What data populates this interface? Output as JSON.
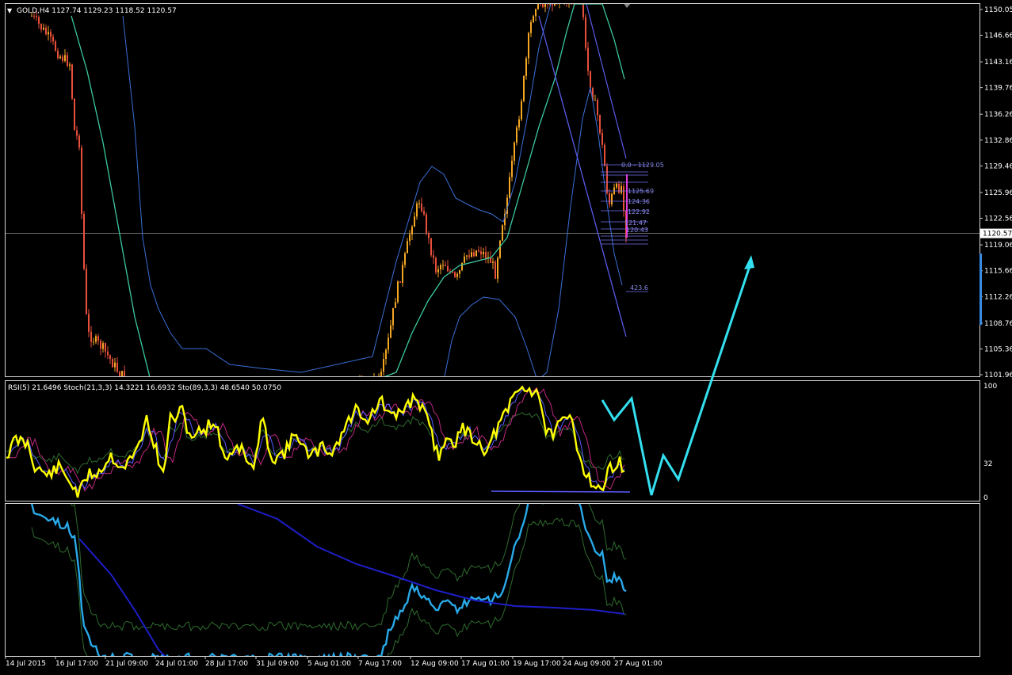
{
  "chart_data": {
    "type": "line",
    "main": {
      "header": "GOLD,H4  1127.74 1129.23 1118.52 1120.57",
      "price_ticks": [
        "1150.05",
        "1146.66",
        "1143.16",
        "1139.76",
        "1136.26",
        "1132.86",
        "1129.46",
        "1125.96",
        "1122.56",
        "1119.06",
        "1115.66",
        "1112.26",
        "1108.76",
        "1105.36",
        "1101.96"
      ],
      "price_tick_values": [
        1150.05,
        1146.66,
        1143.16,
        1139.76,
        1136.26,
        1132.86,
        1129.46,
        1125.96,
        1122.56,
        1119.06,
        1115.66,
        1112.26,
        1108.76,
        1105.36,
        1101.96
      ],
      "ylim": [
        1101.5,
        1150.6
      ],
      "current_price": "1120.57",
      "current_price_value": 1120.57,
      "candle_colors": {
        "up": "#f5a623",
        "down": "#e8503c"
      },
      "fib_levels": [
        {
          "label": "0.0 - 1129.05",
          "price": 1129.05
        },
        {
          "label": "1125.69",
          "price": 1125.69
        },
        {
          "label": "124.36",
          "price": 1124.36
        },
        {
          "label": "122.92",
          "price": 1122.92
        },
        {
          "label": "121.47",
          "price": 1121.47
        },
        {
          "label": "120.43",
          "price": 1120.43
        }
      ],
      "fib_extension": {
        "label": "423.6",
        "price": 1114.6
      }
    },
    "rsi": {
      "header": "RSI(5) 21.6496  Stoch(21,3,3) 14.3221 16.6932  Sto(89,3,3) 48.6540 50.0750",
      "levels": [
        "100",
        "32",
        "0"
      ],
      "level_values": [
        100,
        32,
        0
      ]
    },
    "x_ticks": [
      "14 Jul 2015",
      "16 Jul 17:00",
      "21 Jul 09:00",
      "24 Jul 01:00",
      "28 Jul 17:00",
      "31 Jul 09:00",
      "5 Aug 01:00",
      "7 Aug 17:00",
      "12 Aug 09:00",
      "17 Aug 01:00",
      "19 Aug 17:00",
      "24 Aug 09:00",
      "27 Aug 01:00"
    ],
    "colors": {
      "rsi": "#ffff00",
      "forecast_arrow": "#33e0f0",
      "bands": "#3a6fd8",
      "ma_green": "#3cc8a0",
      "ma_dark": "#1e1ec8",
      "osc": "#29a9e8"
    }
  }
}
